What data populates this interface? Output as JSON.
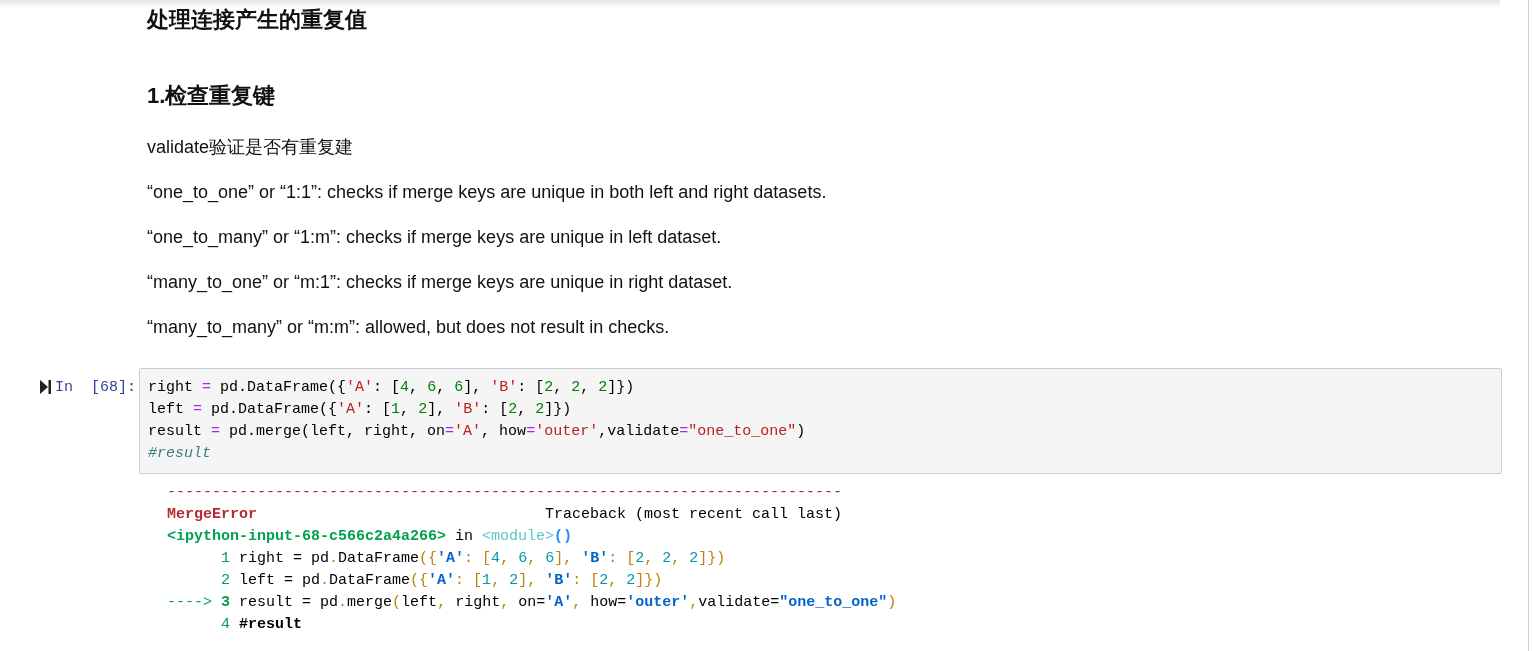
{
  "heading": "处理连接产生的重复值",
  "subheading": "1.检查重复键",
  "paragraphs": [
    "validate验证是否有重复建",
    "“one_to_one” or “1:1”: checks if merge keys are unique in both left and right datasets.",
    "“one_to_many” or “1:m”: checks if merge keys are unique in left dataset.",
    "“many_to_one” or “m:1”: checks if merge keys are unique in right dataset.",
    "“many_to_many” or “m:m”: allowed, but does not result in checks."
  ],
  "cell": {
    "prompt": "In  [68]:",
    "code": [
      [
        {
          "kind": "plain",
          "text": "right "
        },
        {
          "kind": "op",
          "text": "="
        },
        {
          "kind": "plain",
          "text": " pd.DataFrame({"
        },
        {
          "kind": "str",
          "text": "'A'"
        },
        {
          "kind": "plain",
          "text": ": ["
        },
        {
          "kind": "num",
          "text": "4"
        },
        {
          "kind": "plain",
          "text": ", "
        },
        {
          "kind": "num",
          "text": "6"
        },
        {
          "kind": "plain",
          "text": ", "
        },
        {
          "kind": "num",
          "text": "6"
        },
        {
          "kind": "plain",
          "text": "], "
        },
        {
          "kind": "str",
          "text": "'B'"
        },
        {
          "kind": "plain",
          "text": ": ["
        },
        {
          "kind": "num",
          "text": "2"
        },
        {
          "kind": "plain",
          "text": ", "
        },
        {
          "kind": "num",
          "text": "2"
        },
        {
          "kind": "plain",
          "text": ", "
        },
        {
          "kind": "num",
          "text": "2"
        },
        {
          "kind": "plain",
          "text": "]})"
        }
      ],
      [
        {
          "kind": "plain",
          "text": "left "
        },
        {
          "kind": "op",
          "text": "="
        },
        {
          "kind": "plain",
          "text": " pd.DataFrame({"
        },
        {
          "kind": "str",
          "text": "'A'"
        },
        {
          "kind": "plain",
          "text": ": ["
        },
        {
          "kind": "num",
          "text": "1"
        },
        {
          "kind": "plain",
          "text": ", "
        },
        {
          "kind": "num",
          "text": "2"
        },
        {
          "kind": "plain",
          "text": "], "
        },
        {
          "kind": "str",
          "text": "'B'"
        },
        {
          "kind": "plain",
          "text": ": ["
        },
        {
          "kind": "num",
          "text": "2"
        },
        {
          "kind": "plain",
          "text": ", "
        },
        {
          "kind": "num",
          "text": "2"
        },
        {
          "kind": "plain",
          "text": "]})"
        }
      ],
      [
        {
          "kind": "plain",
          "text": "result "
        },
        {
          "kind": "op",
          "text": "="
        },
        {
          "kind": "plain",
          "text": " pd.merge(left, right, on"
        },
        {
          "kind": "op",
          "text": "="
        },
        {
          "kind": "str",
          "text": "'A'"
        },
        {
          "kind": "plain",
          "text": ", how"
        },
        {
          "kind": "op",
          "text": "="
        },
        {
          "kind": "str",
          "text": "'outer'"
        },
        {
          "kind": "plain",
          "text": ",validate"
        },
        {
          "kind": "op",
          "text": "="
        },
        {
          "kind": "str",
          "text": "\"one_to_one\""
        },
        {
          "kind": "plain",
          "text": ")"
        }
      ],
      [
        {
          "kind": "comment",
          "text": "#result"
        }
      ]
    ]
  },
  "traceback": [
    [
      {
        "kind": "rule",
        "text": "---------------------------------------------------------------------------"
      }
    ],
    [
      {
        "kind": "error",
        "text": "MergeError"
      },
      {
        "kind": "plain",
        "text": "                                Traceback (most recent call last)"
      }
    ],
    [
      {
        "kind": "file",
        "text": "<ipython-input-68-c566c2a4a266>"
      },
      {
        "kind": "plain",
        "text": " in "
      },
      {
        "kind": "module",
        "text": "<module>"
      },
      {
        "kind": "call",
        "text": "()"
      }
    ],
    [
      {
        "kind": "lineno",
        "text": "      1 "
      },
      {
        "kind": "plain",
        "text": "right = pd"
      },
      {
        "kind": "punct",
        "text": "."
      },
      {
        "kind": "plain",
        "text": "DataFrame"
      },
      {
        "kind": "punct",
        "text": "({"
      },
      {
        "kind": "str",
        "text": "'A'"
      },
      {
        "kind": "punct",
        "text": ": ["
      },
      {
        "kind": "num",
        "text": "4"
      },
      {
        "kind": "punct",
        "text": ", "
      },
      {
        "kind": "num",
        "text": "6"
      },
      {
        "kind": "punct",
        "text": ", "
      },
      {
        "kind": "num",
        "text": "6"
      },
      {
        "kind": "punct",
        "text": "], "
      },
      {
        "kind": "str",
        "text": "'B'"
      },
      {
        "kind": "punct",
        "text": ": ["
      },
      {
        "kind": "num",
        "text": "2"
      },
      {
        "kind": "punct",
        "text": ", "
      },
      {
        "kind": "num",
        "text": "2"
      },
      {
        "kind": "punct",
        "text": ", "
      },
      {
        "kind": "num",
        "text": "2"
      },
      {
        "kind": "punct",
        "text": "]})"
      }
    ],
    [
      {
        "kind": "lineno",
        "text": "      2 "
      },
      {
        "kind": "plain",
        "text": "left = pd"
      },
      {
        "kind": "punct",
        "text": "."
      },
      {
        "kind": "plain",
        "text": "DataFrame"
      },
      {
        "kind": "punct",
        "text": "({"
      },
      {
        "kind": "str",
        "text": "'A'"
      },
      {
        "kind": "punct",
        "text": ": ["
      },
      {
        "kind": "num",
        "text": "1"
      },
      {
        "kind": "punct",
        "text": ", "
      },
      {
        "kind": "num",
        "text": "2"
      },
      {
        "kind": "punct",
        "text": "], "
      },
      {
        "kind": "str",
        "text": "'B'"
      },
      {
        "kind": "punct",
        "text": ": ["
      },
      {
        "kind": "num",
        "text": "2"
      },
      {
        "kind": "punct",
        "text": ", "
      },
      {
        "kind": "num",
        "text": "2"
      },
      {
        "kind": "punct",
        "text": "]})"
      }
    ],
    [
      {
        "kind": "arrow",
        "text": "----> "
      },
      {
        "kind": "current",
        "text": "3 "
      },
      {
        "kind": "plain",
        "text": "result = pd"
      },
      {
        "kind": "punct",
        "text": "."
      },
      {
        "kind": "plain",
        "text": "merge"
      },
      {
        "kind": "punct",
        "text": "("
      },
      {
        "kind": "plain",
        "text": "left"
      },
      {
        "kind": "punct",
        "text": ", "
      },
      {
        "kind": "plain",
        "text": "right"
      },
      {
        "kind": "punct",
        "text": ", "
      },
      {
        "kind": "plain",
        "text": "on="
      },
      {
        "kind": "str",
        "text": "'A'"
      },
      {
        "kind": "punct",
        "text": ", "
      },
      {
        "kind": "plain",
        "text": "how="
      },
      {
        "kind": "str",
        "text": "'outer'"
      },
      {
        "kind": "punct",
        "text": ","
      },
      {
        "kind": "plain",
        "text": "validate="
      },
      {
        "kind": "str",
        "text": "\"one_to_one\""
      },
      {
        "kind": "punct",
        "text": ")"
      }
    ],
    [
      {
        "kind": "lineno",
        "text": "      4 "
      },
      {
        "kind": "bold",
        "text": "#result"
      }
    ]
  ]
}
